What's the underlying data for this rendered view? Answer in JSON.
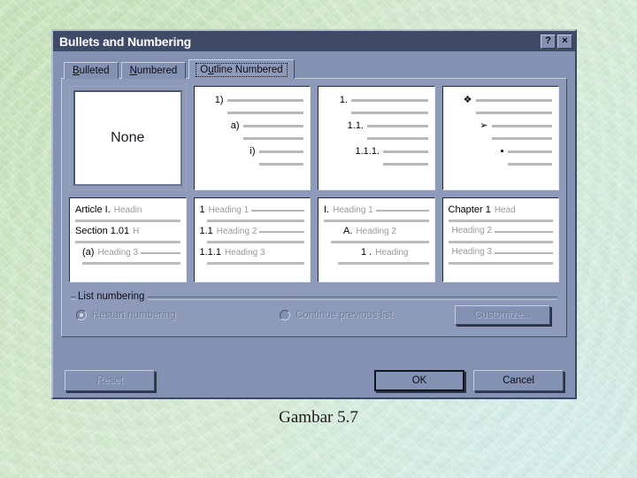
{
  "slide": {
    "caption": "Gambar 5.7",
    "background_color": "#cbe6c4"
  },
  "dialog": {
    "title": "Bullets and Numbering",
    "titlebar_color": "#3f4a66",
    "face_color": "#8d9ab9",
    "help_button": "?",
    "close_button": "×",
    "tabs": [
      {
        "label": "Bulleted",
        "selected": false
      },
      {
        "label": "Numbered",
        "selected": false
      },
      {
        "label": "Outline Numbered",
        "selected": true
      }
    ],
    "gallery": {
      "cell1": {
        "name": "None",
        "label": "None",
        "selected": true
      },
      "cell2": {
        "name": "parenthesis-outline",
        "levels": [
          "1)",
          "a)",
          "i)"
        ]
      },
      "cell3": {
        "name": "legal-outline",
        "levels": [
          "1.",
          "1.1.",
          "1.1.1."
        ]
      },
      "cell4": {
        "name": "symbol-bullets",
        "levels": [
          "❖",
          "➢",
          "▪"
        ]
      },
      "cell5": {
        "name": "article-section-outline",
        "rows": [
          {
            "num": "Article I.",
            "text": "Headin"
          },
          {
            "num": "Section 1.01",
            "text": "H"
          },
          {
            "num": "(a)",
            "text": "Heading 3"
          }
        ]
      },
      "cell6": {
        "name": "numeric-heading-outline",
        "rows": [
          {
            "num": "1",
            "text": "Heading 1"
          },
          {
            "num": "1.1",
            "text": "Heading 2"
          },
          {
            "num": "1.1.1",
            "text": "Heading 3"
          }
        ]
      },
      "cell7": {
        "name": "roman-heading-outline",
        "rows": [
          {
            "num": "I.",
            "text": "Heading 1"
          },
          {
            "num": "A.",
            "text": "Heading 2"
          },
          {
            "num": "1 .",
            "text": "Heading"
          }
        ]
      },
      "cell8": {
        "name": "chapter-heading-outline",
        "rows": [
          {
            "num": "Chapter 1",
            "text": "Head"
          },
          {
            "num": "Heading 2",
            "text": ""
          },
          {
            "num": "Heading 3",
            "text": ""
          }
        ]
      }
    },
    "list_numbering": {
      "group_label": "List numbering",
      "restart_label": "Restart numbering",
      "restart_selected": true,
      "continue_label": "Continue previous list",
      "continue_selected": false,
      "customize_label": "Customize...",
      "disabled": true
    },
    "footer": {
      "reset_label": "Reset",
      "reset_disabled": true,
      "ok_label": "OK",
      "cancel_label": "Cancel"
    }
  }
}
